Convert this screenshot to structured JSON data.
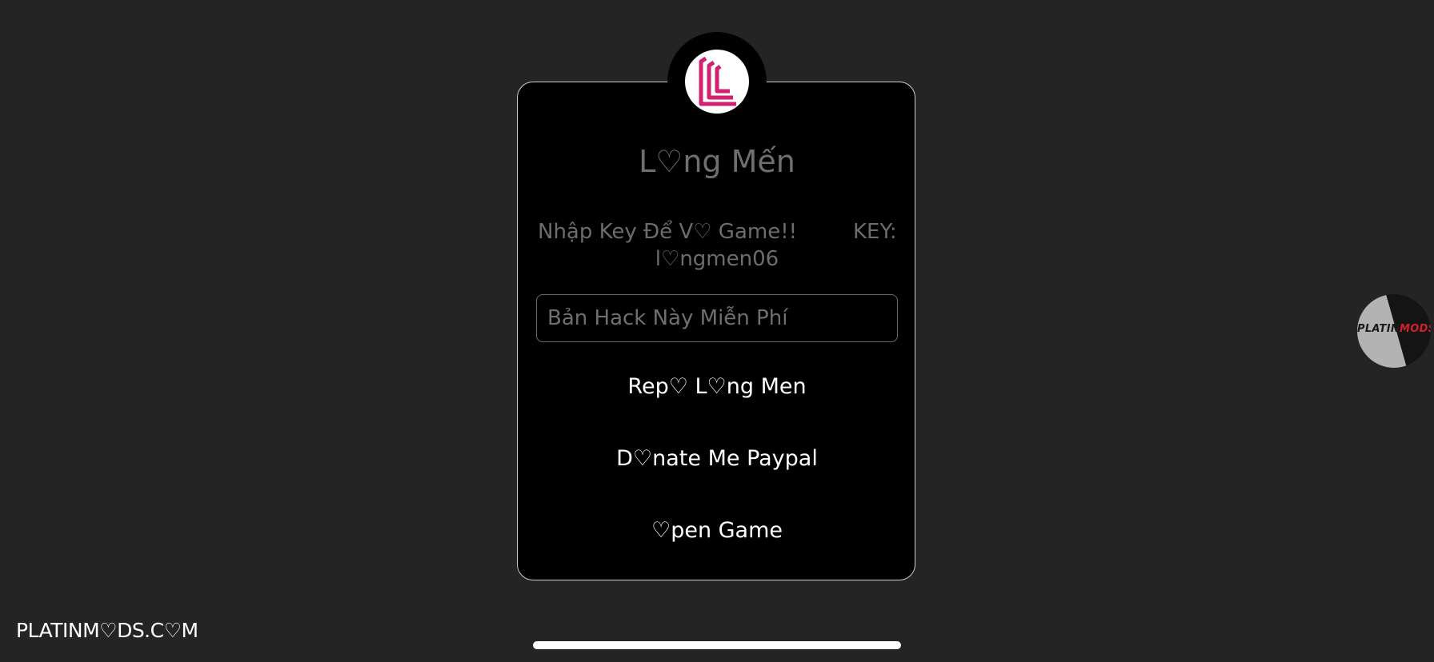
{
  "dialog": {
    "title": "L♡ng Mến",
    "prompt": "Nhập Key Để V♡ Game!!",
    "key_label": "KEY:",
    "key_value": "l♡ngmen06",
    "input": {
      "placeholder": "Bản Hack Này Miễn Phí",
      "value": ""
    },
    "actions": [
      {
        "label": "Rep♡ L♡ng Men"
      },
      {
        "label": "D♡nate Me Paypal"
      },
      {
        "label": "♡pen Game"
      }
    ],
    "logo_icon": "long-men-logo-icon"
  },
  "badge": {
    "text_left": "PLATIN",
    "text_right": "MODS",
    "colors": {
      "light": "#b3b3b3",
      "dark": "#141414",
      "accent": "#d0212a"
    }
  },
  "watermark": "PLATINM♡DS.C♡M",
  "colors": {
    "background": "#242424",
    "dialog": "#000000",
    "logo_pink": "#d0226e",
    "muted_text": "#6f6f6f"
  }
}
